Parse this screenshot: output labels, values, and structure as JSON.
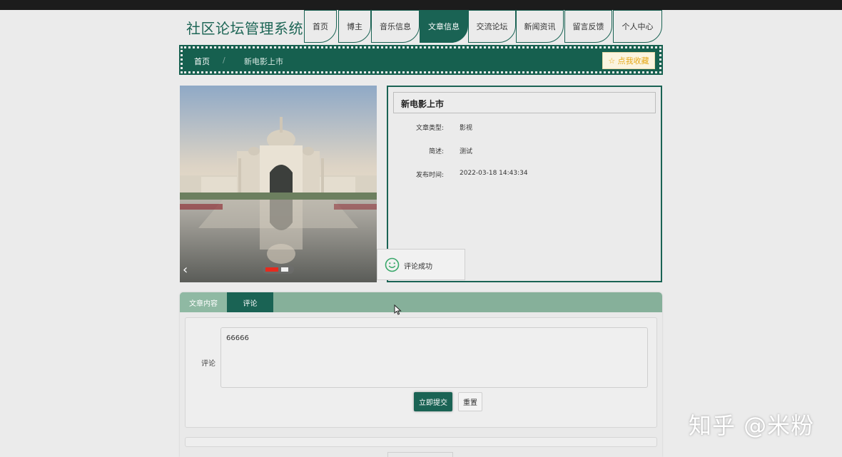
{
  "site": {
    "title": "社区论坛管理系统"
  },
  "nav": {
    "items": [
      {
        "label": "首页"
      },
      {
        "label": "博主"
      },
      {
        "label": "音乐信息"
      },
      {
        "label": "文章信息"
      },
      {
        "label": "交流论坛"
      },
      {
        "label": "新闻资讯"
      },
      {
        "label": "留言反馈"
      },
      {
        "label": "个人中心"
      }
    ],
    "active": "文章信息"
  },
  "breadcrumb": {
    "home": "首页",
    "separator": "/",
    "current": "新电影上市",
    "favorite_label": "☆ 点我收藏"
  },
  "article": {
    "title": "新电影上市",
    "fields": [
      {
        "label": "文章类型:",
        "value": "影视"
      },
      {
        "label": "简述:",
        "value": "测试"
      },
      {
        "label": "发布时间:",
        "value": "2022-03-18 14:43:34"
      }
    ]
  },
  "carousel": {
    "prev_icon": "‹"
  },
  "toast": {
    "message": "评论成功"
  },
  "tabs": {
    "content_label": "文章内容",
    "comment_label": "评论"
  },
  "comment_form": {
    "label": "评论",
    "value": "66666",
    "submit_label": "立即提交",
    "reset_label": "重置"
  },
  "watermark": {
    "text": "知乎 @米粉"
  },
  "colors": {
    "primary": "#1a6354",
    "tab_header": "#86b09a",
    "background": "#ebebeb",
    "favorite": "#e6a817"
  }
}
